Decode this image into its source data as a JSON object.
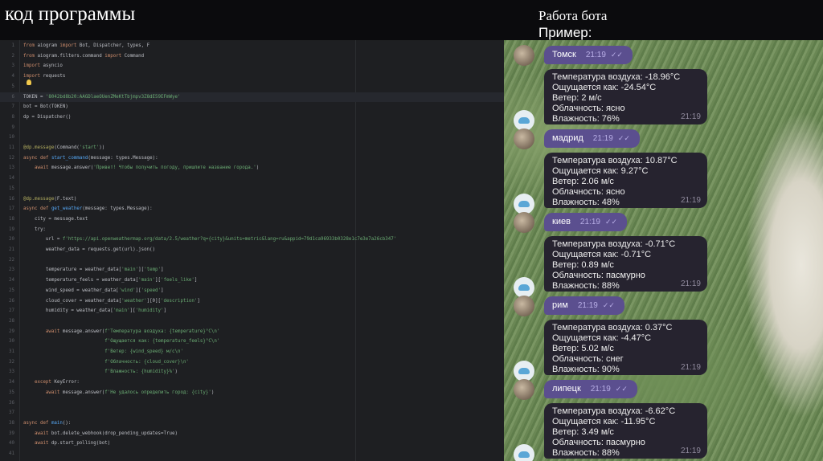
{
  "header": {
    "title": "код программы",
    "right_title": "Работа бота",
    "right_subtitle": "Пример:"
  },
  "code": {
    "current_line": 6,
    "lines": [
      "from aiogram import Bot, Dispatcher, types, F",
      "from aiogram.filters.command import Command",
      "import asyncio",
      "import requests",
      "",
      "TOKEN = '8042bd8b20:AAGDlaeOUenZMeKtTbjmpv3Z8dE59EFmWye'",
      "bot = Bot(TOKEN)",
      "dp = Dispatcher()",
      "",
      "",
      "@dp.message(Command('start'))",
      "async def start_command(message: types.Message):",
      "    await message.answer('Привет! Чтобы получить погоду, пришлите название города.')",
      "",
      "",
      "@dp.message(F.text)",
      "async def get_weather(message: types.Message):",
      "    city = message.text",
      "    try:",
      "        url = f'https://api.openweathermap.org/data/2.5/weather?q={city}&units=metric&lang=ru&appid=79d1ca96933b0328e1c7e3e7a26cb347'",
      "        weather_data = requests.get(url).json()",
      "",
      "        temperature = weather_data['main']['temp']",
      "        temperature_feels = weather_data['main']['feels_like']",
      "        wind_speed = weather_data['wind']['speed']",
      "        cloud_cover = weather_data['weather'][0]['description']",
      "        humidity = weather_data['main']['humidity']",
      "",
      "        await message.answer(f'Температура воздуха: {temperature}°C\\n'",
      "                             f'Ощущается как: {temperature_feels}°C\\n'",
      "                             f'Ветер: {wind_speed} м/с\\n'",
      "                             f'Облачность: {cloud_cover}\\n'",
      "                             f'Влажность: {humidity}%')",
      "    except KeyError:",
      "        await message.answer(f'Не удалось определить город: {city}')",
      "",
      "",
      "async def main():",
      "    await bot.delete_webhook(drop_pending_updates=True)",
      "    await dp.start_polling(bot)",
      ""
    ]
  },
  "chat": {
    "messages": [
      {
        "city": "Томск",
        "time": "21:19",
        "reply": {
          "lines": [
            "Температура воздуха: -18.96°C",
            "Ощущается как: -24.54°C",
            "Ветер: 2 м/с",
            "Облачность: ясно",
            "Влажность: 76%"
          ],
          "time": "21:19"
        }
      },
      {
        "city": "мадрид",
        "time": "21:19",
        "reply": {
          "lines": [
            "Температура воздуха: 10.87°C",
            "Ощущается как: 9.27°C",
            "Ветер: 2.06 м/с",
            "Облачность: ясно",
            "Влажность: 48%"
          ],
          "time": "21:19"
        }
      },
      {
        "city": "киев",
        "time": "21:19",
        "reply": {
          "lines": [
            "Температура воздуха: -0.71°C",
            "Ощущается как: -0.71°C",
            "Ветер: 0.89 м/с",
            "Облачность: пасмурно",
            "Влажность: 88%"
          ],
          "time": "21:19"
        }
      },
      {
        "city": "рим",
        "time": "21:19",
        "reply": {
          "lines": [
            "Температура воздуха: 0.37°C",
            "Ощущается как: -4.47°C",
            "Ветер: 5.02 м/с",
            "Облачность: снег",
            "Влажность: 90%"
          ],
          "time": "21:19"
        }
      },
      {
        "city": "липецк",
        "time": "21:19",
        "reply": {
          "lines": [
            "Температура воздуха: -6.62°C",
            "Ощущается как: -11.95°C",
            "Ветер: 3.49 м/с",
            "Облачность: пасмурно",
            "Влажность: 88%"
          ],
          "time": "21:19"
        }
      }
    ]
  }
}
